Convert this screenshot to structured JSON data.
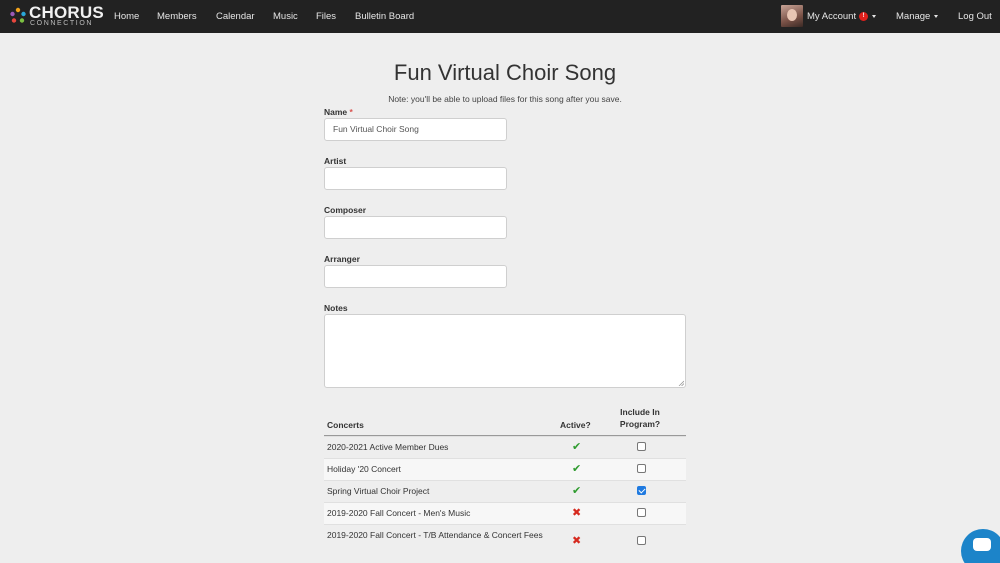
{
  "nav": {
    "logo_word": "CHORUS",
    "logo_sub": "CONNECTION",
    "links": [
      "Home",
      "Members",
      "Calendar",
      "Music",
      "Files",
      "Bulletin Board"
    ],
    "my_account": "My Account",
    "notif_count": "!",
    "manage": "Manage",
    "logout": "Log Out"
  },
  "page": {
    "title": "Fun Virtual Choir Song",
    "note": "Note: you'll be able to upload files for this song after you save."
  },
  "form": {
    "name_label": "Name",
    "name_required": "*",
    "name_value": "Fun Virtual Choir Song",
    "artist_label": "Artist",
    "artist_value": "",
    "composer_label": "Composer",
    "composer_value": "",
    "arranger_label": "Arranger",
    "arranger_value": "",
    "notes_label": "Notes"
  },
  "concerts": {
    "col_concerts": "Concerts",
    "col_active": "Active?",
    "col_include_1": "Include In",
    "col_include_2": "Program?",
    "rows": [
      {
        "name": "2020-2021 Active Member Dues",
        "active": true,
        "included": false
      },
      {
        "name": "Holiday '20 Concert",
        "active": true,
        "included": false
      },
      {
        "name": "Spring Virtual Choir Project",
        "active": true,
        "included": true
      },
      {
        "name": "2019-2020 Fall Concert - Men's Music",
        "active": false,
        "included": false
      },
      {
        "name": "2019-2020 Fall Concert - T/B Attendance & Concert Fees",
        "active": false,
        "included": false
      }
    ]
  },
  "colors": {
    "navbar": "#222222",
    "active_check": "#2e9b2e",
    "inactive_cross": "#d62a1f",
    "chat": "#1c84c9"
  },
  "icons": {
    "active": "✔",
    "inactive": "✖"
  }
}
